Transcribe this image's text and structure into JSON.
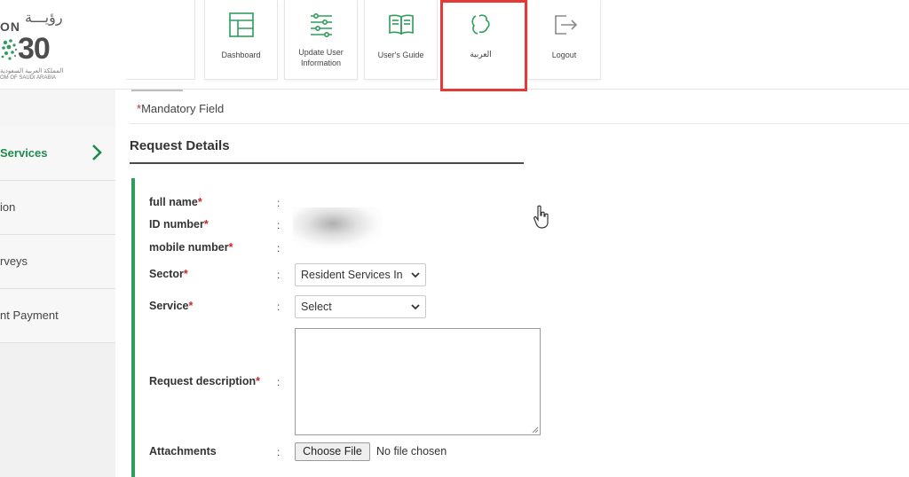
{
  "logo": {
    "arabic_text": "رؤيـــة",
    "vision_text": "ON",
    "number_text": "30",
    "subtitle_arabic": "المملكة العربية السعودية",
    "subtitle_english": "OM OF SAUDI ARABIA"
  },
  "nav": {
    "tiles": [
      {
        "label": "Dashboard",
        "icon": "dashboard-icon"
      },
      {
        "label": "Update User Information",
        "icon": "update-user-icon"
      },
      {
        "label": "User's Guide",
        "icon": "book-icon"
      },
      {
        "label": "العربية",
        "icon": "language-icon"
      },
      {
        "label": "Logout",
        "icon": "logout-icon"
      }
    ]
  },
  "sidebar": {
    "items": [
      {
        "label": "Services",
        "active": true
      },
      {
        "label": "ion"
      },
      {
        "label": "rveys"
      },
      {
        "label": "nt Payment"
      }
    ]
  },
  "form": {
    "mandatory_label": "Mandatory Field",
    "section_title": "Request Details",
    "fields": {
      "full_name": "full name",
      "id_number": "ID number",
      "mobile_number": "mobile number",
      "sector": "Sector",
      "service": "Service",
      "request_description": "Request description",
      "attachments": "Attachments"
    },
    "colon": ":",
    "required_mark": "*",
    "sector_value": "Resident Services In",
    "service_value": "Select",
    "file_button_label": "Choose File",
    "file_status": "No file chosen"
  },
  "colors": {
    "accent_green": "#2e9d5b",
    "highlight_red": "#e53935",
    "required_red": "#c62828"
  }
}
